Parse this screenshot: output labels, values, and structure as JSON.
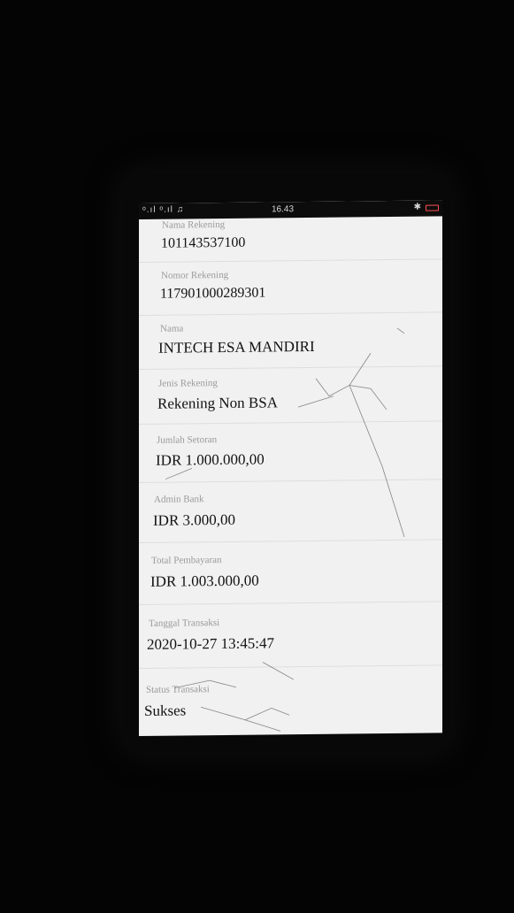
{
  "status_bar": {
    "left_icons": "ᵒ.ıl ᵒ.ıl ♫",
    "time": "16.43",
    "right_icons": "✱"
  },
  "fields": [
    {
      "label": "Nama Rekening",
      "value": "101143537100"
    },
    {
      "label": "Nomor Rekening",
      "value": "117901000289301"
    },
    {
      "label": "Nama",
      "value": "INTECH ESA MANDIRI"
    },
    {
      "label": "Jenis Rekening",
      "value": "Rekening Non BSA"
    },
    {
      "label": "Jumlah Setoran",
      "value": "IDR 1.000.000,00"
    },
    {
      "label": "Admin Bank",
      "value": "IDR 3.000,00"
    },
    {
      "label": "Total Pembayaran",
      "value": "IDR 1.003.000,00"
    },
    {
      "label": "Tanggal Transaksi",
      "value": "2020-10-27 13:45:47"
    },
    {
      "label": "Status Transaksi",
      "value": "Sukses"
    }
  ]
}
